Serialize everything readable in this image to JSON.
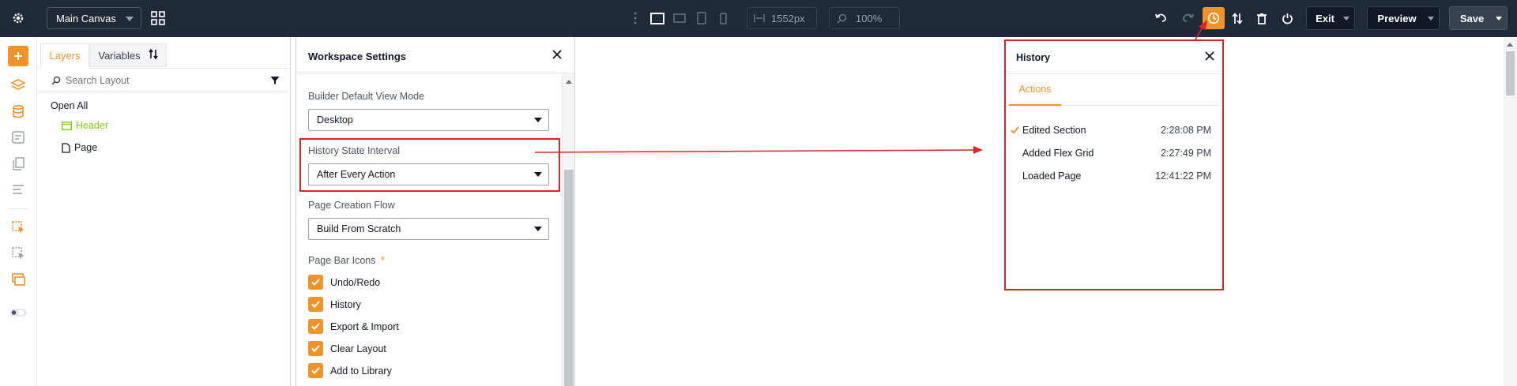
{
  "topbar": {
    "canvas_selector": "Main Canvas",
    "width_value": "1552px",
    "zoom_value": "100%",
    "exit_label": "Exit",
    "preview_label": "Preview",
    "save_label": "Save"
  },
  "layers_panel": {
    "tabs": [
      "Layers",
      "Variables"
    ],
    "search_placeholder": "Search Layout",
    "open_all": "Open All",
    "items": [
      "Header",
      "Page"
    ]
  },
  "workspace": {
    "title": "Workspace Settings",
    "fields": [
      {
        "label": "Builder Default View Mode",
        "value": "Desktop"
      },
      {
        "label": "History State Interval",
        "value": "After Every Action"
      },
      {
        "label": "Page Creation Flow",
        "value": "Build From Scratch"
      }
    ],
    "page_bar_icons_label": "Page Bar Icons",
    "required_mark": "*",
    "checkboxes": [
      "Undo/Redo",
      "History",
      "Export & Import",
      "Clear Layout",
      "Add to Library"
    ]
  },
  "history": {
    "title": "History",
    "tab": "Actions",
    "entries": [
      {
        "action": "Edited Section",
        "time": "2:28:08 PM"
      },
      {
        "action": "Added Flex Grid",
        "time": "2:27:49 PM"
      },
      {
        "action": "Loaded Page",
        "time": "12:41:22 PM"
      }
    ]
  },
  "colors": {
    "topbar_bg": "#1f2937",
    "accent_orange": "#f0932b",
    "highlight_red": "#dc2626",
    "layer_green": "#84cc16"
  },
  "icons": [
    "gear-icon",
    "grid-icon",
    "drag-handle-icon",
    "desktop-icon",
    "tablet-landscape-icon",
    "tablet-portrait-icon",
    "mobile-icon",
    "width-icon",
    "zoom-icon",
    "undo-icon",
    "redo-icon",
    "history-clock-icon",
    "sort-icon",
    "trash-icon",
    "power-icon",
    "plus-icon",
    "layers-icon",
    "database-icon",
    "form-icon",
    "pages-icon",
    "list-icon",
    "click-icon",
    "select-icon",
    "stack-icon",
    "toggle-icon",
    "search-icon",
    "filter-icon",
    "folder-icon",
    "page-icon",
    "close-icon",
    "check-icon",
    "chevron-down-icon"
  ]
}
